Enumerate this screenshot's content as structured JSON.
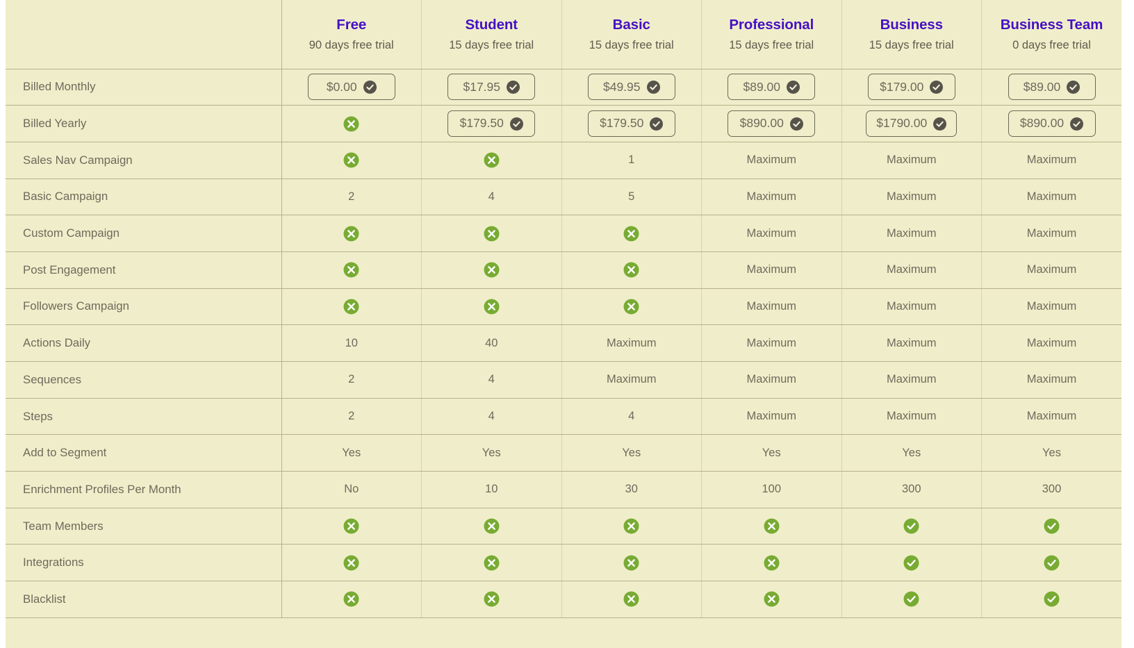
{
  "colors": {
    "page_background": "#f0eeca",
    "plan_name": "#4510c4",
    "body_text": "#6d6a5c",
    "grid_line": "#b5b18d",
    "grid_line_light": "#d6d3b0",
    "green_icon": "#78ab33",
    "dark_badge": "#56534a"
  },
  "table": {
    "feature_column_header": "",
    "plans": [
      {
        "name": "Free",
        "trial": "90 days free trial"
      },
      {
        "name": "Student",
        "trial": "15 days free trial"
      },
      {
        "name": "Basic",
        "trial": "15 days free trial"
      },
      {
        "name": "Professional",
        "trial": "15 days free trial"
      },
      {
        "name": "Business",
        "trial": "15 days free trial"
      },
      {
        "name": "Business Team",
        "trial": "0 days free trial"
      }
    ],
    "rows": [
      {
        "label": "Billed Monthly",
        "cells": [
          {
            "type": "price",
            "text": "$0.00"
          },
          {
            "type": "price",
            "text": "$17.95"
          },
          {
            "type": "price",
            "text": "$49.95"
          },
          {
            "type": "price",
            "text": "$89.00"
          },
          {
            "type": "price",
            "text": "$179.00"
          },
          {
            "type": "price",
            "text": "$89.00"
          }
        ]
      },
      {
        "label": "Billed Yearly",
        "cells": [
          {
            "type": "cross"
          },
          {
            "type": "price",
            "text": "$179.50"
          },
          {
            "type": "price",
            "text": "$179.50"
          },
          {
            "type": "price",
            "text": "$890.00"
          },
          {
            "type": "price",
            "text": "$1790.00"
          },
          {
            "type": "price",
            "text": "$890.00"
          }
        ]
      },
      {
        "label": "Sales Nav Campaign",
        "cells": [
          {
            "type": "cross"
          },
          {
            "type": "cross"
          },
          {
            "type": "text",
            "text": "1"
          },
          {
            "type": "text",
            "text": "Maximum"
          },
          {
            "type": "text",
            "text": "Maximum"
          },
          {
            "type": "text",
            "text": "Maximum"
          }
        ]
      },
      {
        "label": "Basic Campaign",
        "cells": [
          {
            "type": "text",
            "text": "2"
          },
          {
            "type": "text",
            "text": "4"
          },
          {
            "type": "text",
            "text": "5"
          },
          {
            "type": "text",
            "text": "Maximum"
          },
          {
            "type": "text",
            "text": "Maximum"
          },
          {
            "type": "text",
            "text": "Maximum"
          }
        ]
      },
      {
        "label": "Custom Campaign",
        "cells": [
          {
            "type": "cross"
          },
          {
            "type": "cross"
          },
          {
            "type": "cross"
          },
          {
            "type": "text",
            "text": "Maximum"
          },
          {
            "type": "text",
            "text": "Maximum"
          },
          {
            "type": "text",
            "text": "Maximum"
          }
        ]
      },
      {
        "label": "Post Engagement",
        "cells": [
          {
            "type": "cross"
          },
          {
            "type": "cross"
          },
          {
            "type": "cross"
          },
          {
            "type": "text",
            "text": "Maximum"
          },
          {
            "type": "text",
            "text": "Maximum"
          },
          {
            "type": "text",
            "text": "Maximum"
          }
        ]
      },
      {
        "label": "Followers Campaign",
        "cells": [
          {
            "type": "cross"
          },
          {
            "type": "cross"
          },
          {
            "type": "cross"
          },
          {
            "type": "text",
            "text": "Maximum"
          },
          {
            "type": "text",
            "text": "Maximum"
          },
          {
            "type": "text",
            "text": "Maximum"
          }
        ]
      },
      {
        "label": "Actions Daily",
        "cells": [
          {
            "type": "text",
            "text": "10"
          },
          {
            "type": "text",
            "text": "40"
          },
          {
            "type": "text",
            "text": "Maximum"
          },
          {
            "type": "text",
            "text": "Maximum"
          },
          {
            "type": "text",
            "text": "Maximum"
          },
          {
            "type": "text",
            "text": "Maximum"
          }
        ]
      },
      {
        "label": "Sequences",
        "cells": [
          {
            "type": "text",
            "text": "2"
          },
          {
            "type": "text",
            "text": "4"
          },
          {
            "type": "text",
            "text": "Maximum"
          },
          {
            "type": "text",
            "text": "Maximum"
          },
          {
            "type": "text",
            "text": "Maximum"
          },
          {
            "type": "text",
            "text": "Maximum"
          }
        ]
      },
      {
        "label": "Steps",
        "cells": [
          {
            "type": "text",
            "text": "2"
          },
          {
            "type": "text",
            "text": "4"
          },
          {
            "type": "text",
            "text": "4"
          },
          {
            "type": "text",
            "text": "Maximum"
          },
          {
            "type": "text",
            "text": "Maximum"
          },
          {
            "type": "text",
            "text": "Maximum"
          }
        ]
      },
      {
        "label": "Add to Segment",
        "cells": [
          {
            "type": "text",
            "text": "Yes"
          },
          {
            "type": "text",
            "text": "Yes"
          },
          {
            "type": "text",
            "text": "Yes"
          },
          {
            "type": "text",
            "text": "Yes"
          },
          {
            "type": "text",
            "text": "Yes"
          },
          {
            "type": "text",
            "text": "Yes"
          }
        ]
      },
      {
        "label": "Enrichment Profiles Per Month",
        "cells": [
          {
            "type": "text",
            "text": "No"
          },
          {
            "type": "text",
            "text": "10"
          },
          {
            "type": "text",
            "text": "30"
          },
          {
            "type": "text",
            "text": "100"
          },
          {
            "type": "text",
            "text": "300"
          },
          {
            "type": "text",
            "text": "300"
          }
        ]
      },
      {
        "label": "Team Members",
        "cells": [
          {
            "type": "cross"
          },
          {
            "type": "cross"
          },
          {
            "type": "cross"
          },
          {
            "type": "cross"
          },
          {
            "type": "check"
          },
          {
            "type": "check"
          }
        ]
      },
      {
        "label": "Integrations",
        "cells": [
          {
            "type": "cross"
          },
          {
            "type": "cross"
          },
          {
            "type": "cross"
          },
          {
            "type": "cross"
          },
          {
            "type": "check"
          },
          {
            "type": "check"
          }
        ]
      },
      {
        "label": "Blacklist",
        "cells": [
          {
            "type": "cross"
          },
          {
            "type": "cross"
          },
          {
            "type": "cross"
          },
          {
            "type": "cross"
          },
          {
            "type": "check"
          },
          {
            "type": "check"
          }
        ]
      }
    ]
  },
  "icons": {
    "cross": "cross-circle-icon",
    "check": "check-circle-icon",
    "price_badge": "check-badge-icon"
  }
}
